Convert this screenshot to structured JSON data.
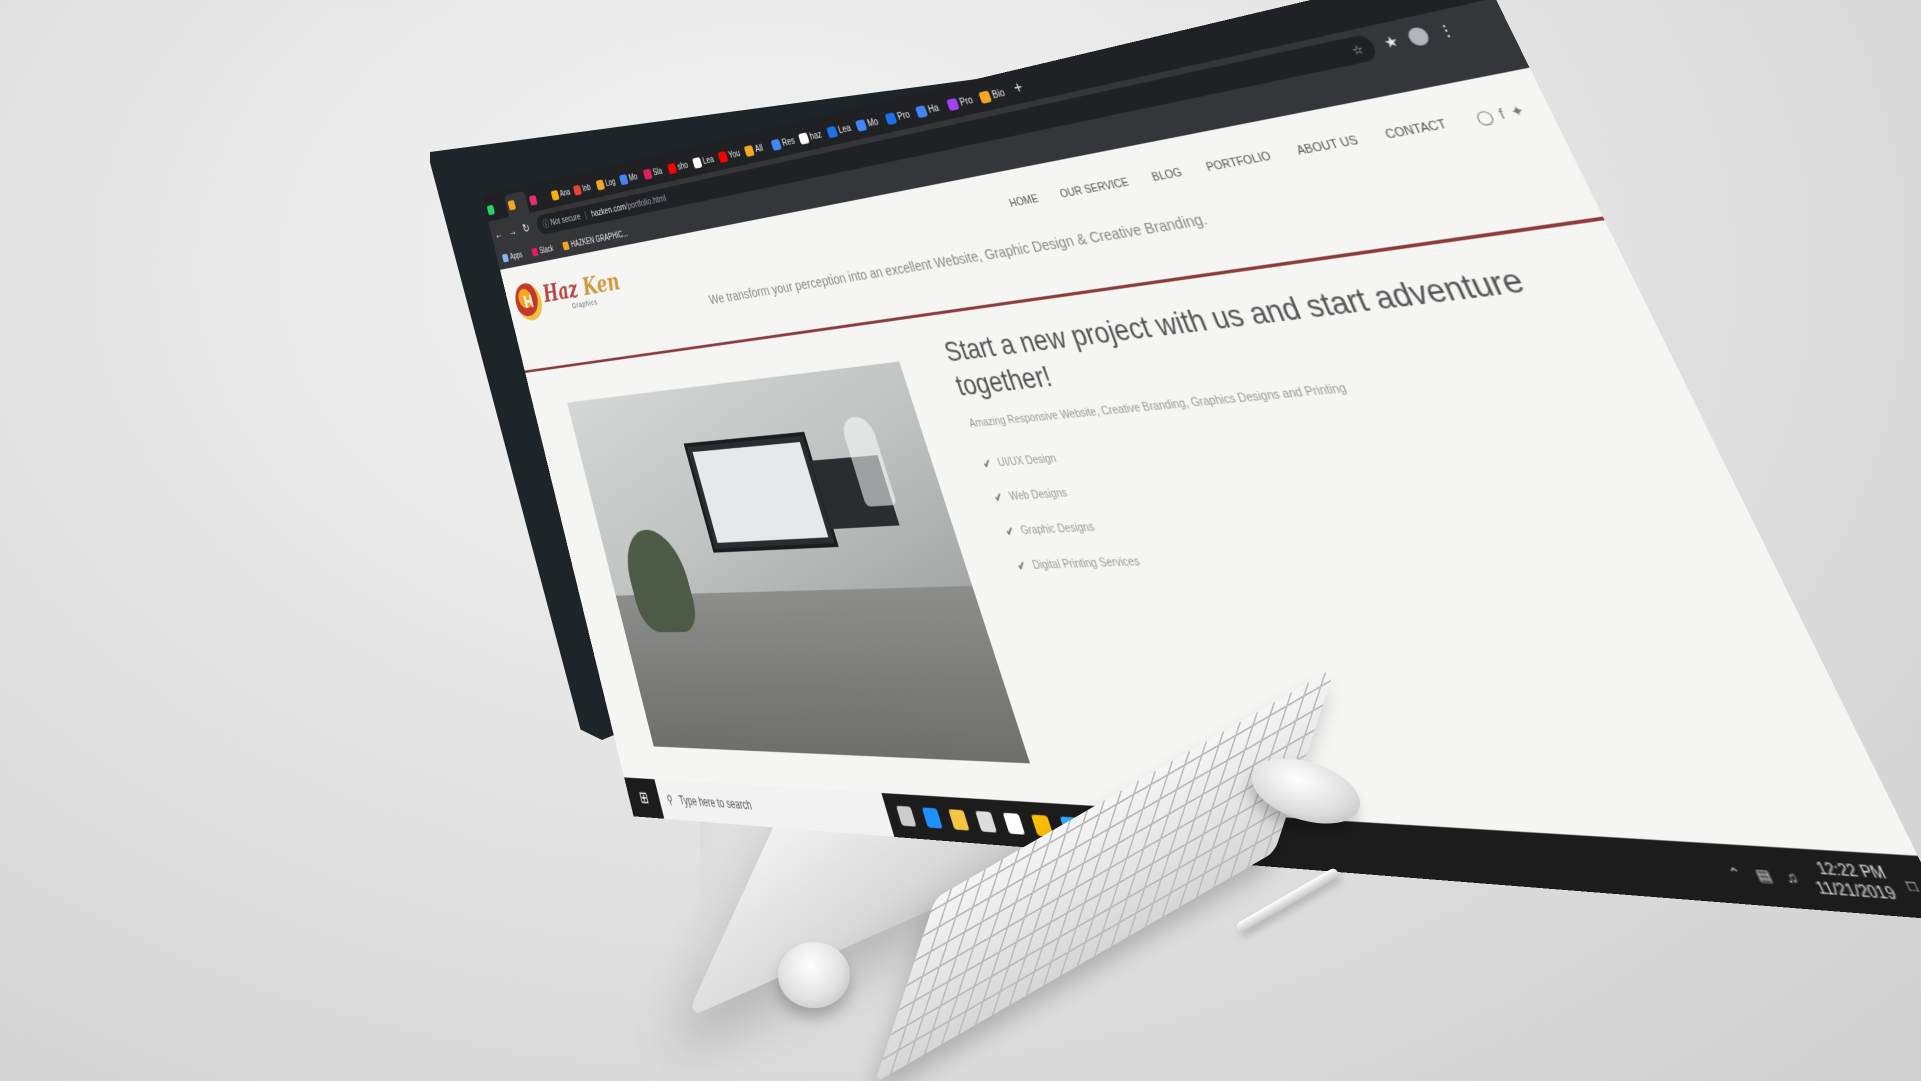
{
  "browser": {
    "tabs": [
      {
        "label": "",
        "color": "#25d366",
        "icon": "whatsapp-icon"
      },
      {
        "label": "",
        "color": "#f5a623",
        "icon": "hazken-favicon",
        "active": true
      },
      {
        "label": "",
        "color": "#e1306c",
        "icon": "instagram-icon"
      },
      {
        "label": "Ana",
        "color": "#f4b400",
        "icon": "analytics-icon"
      },
      {
        "label": "Inb",
        "color": "#ea4335",
        "icon": "gmail-icon"
      },
      {
        "label": "Log",
        "color": "#f5a623",
        "icon": "hazken-favicon"
      },
      {
        "label": "Mo",
        "color": "#4285f4",
        "icon": "page-icon"
      },
      {
        "label": "Sla",
        "color": "#e01e5a",
        "icon": "slack-icon"
      },
      {
        "label": "sho",
        "color": "#ff0000",
        "icon": "youtube-icon"
      },
      {
        "label": "Lea",
        "color": "#ffffff",
        "icon": "medium-icon"
      },
      {
        "label": "You",
        "color": "#ff0000",
        "icon": "youtube-icon"
      },
      {
        "label": "All",
        "color": "#f5a623",
        "icon": "hazken-favicon"
      },
      {
        "label": "Res",
        "color": "#4285f4",
        "icon": "page-icon"
      },
      {
        "label": "haz",
        "color": "#ffffff",
        "icon": "globe-icon"
      },
      {
        "label": "Lea",
        "color": "#1a73e8",
        "icon": "page-icon"
      },
      {
        "label": "Mo",
        "color": "#4285f4",
        "icon": "page-icon"
      },
      {
        "label": "Pro",
        "color": "#1a73e8",
        "icon": "page-icon"
      },
      {
        "label": "Ha",
        "color": "#4285f4",
        "icon": "page-icon"
      },
      {
        "label": "Pro",
        "color": "#a142f4",
        "icon": "page-icon"
      },
      {
        "label": "Bio",
        "color": "#f5a623",
        "icon": "hazken-favicon"
      }
    ],
    "new_tab": "+",
    "window_controls": [
      "–",
      "□",
      "✕"
    ],
    "not_secure": "Not secure",
    "url_host": "hazken.com",
    "url_path": "/portfolio.html",
    "bookmarks": [
      {
        "label": "Apps",
        "color": "#8ab4f8",
        "icon": "apps-grid-icon"
      },
      {
        "label": "Slack",
        "color": "#e01e5a",
        "icon": "slack-icon"
      },
      {
        "label": "HAZKEN GRAPHIC...",
        "color": "#f5a623",
        "icon": "hazken-favicon"
      }
    ]
  },
  "site": {
    "logo_letter": "H",
    "logo_name_1": "Haz",
    "logo_name_2": "Ken",
    "logo_sub": "Graphics",
    "menu": [
      "HOME",
      "OUR SERVICE",
      "BLOG",
      "PORTFOLIO",
      "ABOUT US",
      "CONTACT"
    ],
    "social": [
      "instagram-icon",
      "facebook-icon",
      "twitter-icon"
    ],
    "tagline": "We transform your perception into an excellent Website, Graphic Design & Creative Branding.",
    "hero_title": "Start a new project with us and start adventure together!",
    "hero_sub": "Amazing Responsive Website, Creative Branding, Graphics Designs and Printing",
    "services": [
      "UI/UX Design",
      "Web Designs",
      "Graphic Designs",
      "Digital Printing Services"
    ],
    "accent": "#8e3a3a"
  },
  "taskbar": {
    "search_placeholder": "Type here to search",
    "apps": [
      {
        "name": "task-view-icon",
        "color": "#cccccc"
      },
      {
        "name": "edge-icon",
        "color": "#1e90ff"
      },
      {
        "name": "file-explorer-icon",
        "color": "#f4c542"
      },
      {
        "name": "store-icon",
        "color": "#dddddd"
      },
      {
        "name": "mail-icon",
        "color": "#ffffff"
      },
      {
        "name": "chrome-icon",
        "color": "#fbbc05"
      },
      {
        "name": "photoshop-icon",
        "color": "#31a8ff"
      },
      {
        "name": "app-icon",
        "color": "#3c9a3c"
      },
      {
        "name": "skype-icon",
        "color": "#00aff0"
      },
      {
        "name": "vlc-icon",
        "color": "#ff8800"
      }
    ],
    "time": "12:22 PM",
    "date": "11/21/2019"
  }
}
